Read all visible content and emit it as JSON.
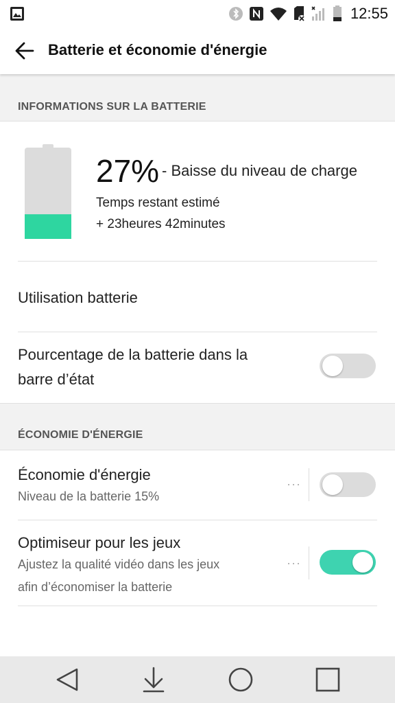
{
  "status_bar": {
    "time": "12:55",
    "icons": [
      "gallery-icon",
      "bluetooth-icon",
      "nfc-icon",
      "wifi-icon",
      "sd-card-icon",
      "signal-icon",
      "battery-icon"
    ]
  },
  "header": {
    "title": "Batterie et économie d'énergie"
  },
  "battery_info": {
    "section_title": "INFORMATIONS SUR LA BATTERIE",
    "percent": "27%",
    "status": "- Baisse du niveau de charge",
    "estimate_label": "Temps restant estimé",
    "estimate_value": "+ 23heures 42minutes",
    "level_fraction": 0.27,
    "fill_color": "#2ed6a0",
    "usage_label": "Utilisation batterie",
    "percent_in_statusbar_label": "Pourcentage de la batterie dans la",
    "percent_in_statusbar_label_2": "barre d’état",
    "percent_in_statusbar_on": false
  },
  "power_saving": {
    "section_title": "ÉCONOMIE D'ÉNERGIE",
    "items": [
      {
        "title": "Économie d'énergie",
        "subtitle": "Niveau de la batterie 15%",
        "enabled": false
      },
      {
        "title": "Optimiseur pour les jeux",
        "subtitle": "Ajustez la qualité vidéo dans les jeux",
        "subtitle_2": "afin d’économiser la batterie",
        "enabled": true
      }
    ],
    "more_glyph": "···"
  },
  "accent_color": "#3ed3b0",
  "navbar": {
    "buttons": [
      "back-nav-icon",
      "notifications-down-icon",
      "home-icon",
      "recents-icon"
    ]
  }
}
